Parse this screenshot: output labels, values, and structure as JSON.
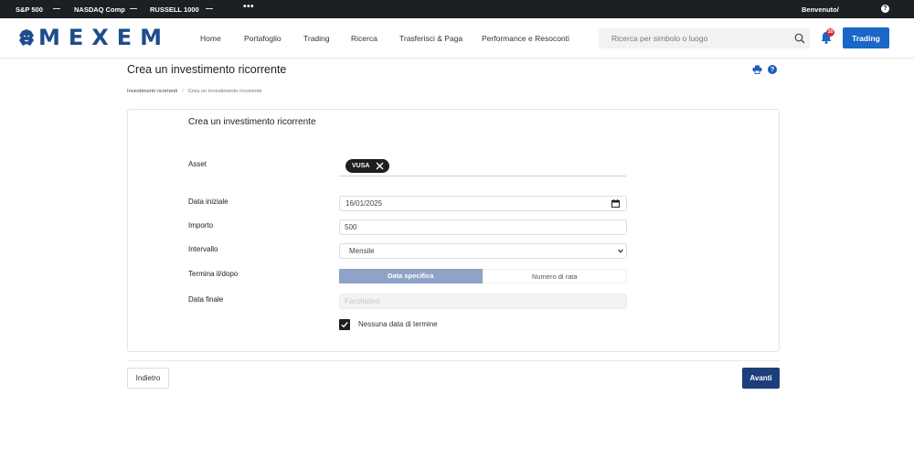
{
  "ticker": {
    "items": [
      "S&P 500",
      "NASDAQ Comp",
      "RUSSELL 1000"
    ],
    "separator": "—",
    "more": "•••",
    "welcome": "Benvenuto/",
    "help_glyph": "?"
  },
  "header": {
    "brand": "MEXEM",
    "nav": [
      "Home",
      "Portafoglio",
      "Trading",
      "Ricerca",
      "Trasferisci & Paga",
      "Performance e Resoconti"
    ],
    "search_placeholder": "Ricerca per simbolo o luogo",
    "notification_count": "10",
    "trading_button": "Trading",
    "colors": {
      "brand": "#1d4c8f",
      "trading_button": "#1a66c9",
      "badge": "#d32f2f"
    }
  },
  "page": {
    "title": "Crea un investimento ricorrente",
    "help_glyph": "?",
    "breadcrumb": [
      "Investimenti ricorrenti",
      "Crea un investimento ricorrente"
    ],
    "breadcrumb_separator": "/"
  },
  "form": {
    "title": "Crea un investimento ricorrente",
    "labels": {
      "asset": "Asset",
      "start_date": "Data iniziale",
      "amount": "Importo",
      "interval": "Intervallo",
      "end_by": "Termina il/dopo",
      "end_date": "Data finale"
    },
    "asset_chip": "VUSA",
    "start_date_value": "16/01/2025",
    "amount_value": "500",
    "interval_value": "Mensile",
    "end_toggle": {
      "active": "Data specifica",
      "inactive": "Numero di rata"
    },
    "end_date_placeholder": "Facoltativo",
    "no_end_date_label": "Nessuna data di termine",
    "no_end_date_checked": true
  },
  "footer": {
    "back_label": "Indietro",
    "next_label": "Avanti",
    "colors": {
      "next_button": "#1c3e7a"
    }
  },
  "icons": [
    "lion-logo-icon",
    "search-icon",
    "bell-icon",
    "print-icon",
    "help-icon",
    "close-icon",
    "calendar-icon",
    "chevron-down-icon",
    "checkmark-icon"
  ]
}
